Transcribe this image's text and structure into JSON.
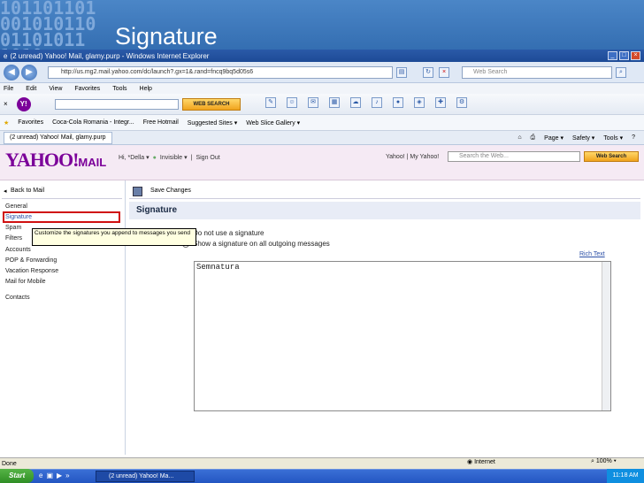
{
  "slide": {
    "binary_deco": "101101101\n001010110\n01101011\n1010",
    "title": "Signature"
  },
  "window": {
    "title": "(2 unread) Yahoo! Mail, glamy.purp - Windows Internet Explorer",
    "url": "http://us.mg2.mail.yahoo.com/dc/launch?.gx=1&.rand=fncq9bq5d05s6",
    "websearch_placeholder": "Web Search"
  },
  "menu": [
    "File",
    "Edit",
    "View",
    "Favorites",
    "Tools",
    "Help"
  ],
  "toolbar": {
    "web_search_btn": "WEB SEARCH"
  },
  "favorites": {
    "label": "Favorites",
    "items": [
      "Coca-Cola Romania - Integr...",
      "Free Hotmail",
      "Suggested Sites ▾",
      "Web Slice Gallery ▾"
    ]
  },
  "tab": {
    "title": "(2 unread) Yahoo! Mail, glamy.purp"
  },
  "cmdbar": [
    "Page ▾",
    "Safety ▾",
    "Tools ▾"
  ],
  "yahoo": {
    "logo": "YAHOO!",
    "logo_mail": "MAIL",
    "greeting": "Hi, *Della ▾",
    "invisible": "Invisible ▾",
    "signout": "Sign Out",
    "links": "Yahoo! | My Yahoo!",
    "search_placeholder": "Search the Web...",
    "search_btn": "Web Search"
  },
  "leftnav": {
    "back": "Back to Mail",
    "general": "General",
    "signature": "Signature",
    "spam": "Spam",
    "filters": "Filters",
    "accounts": "Accounts",
    "pop": "POP & Forwarding",
    "vacation": "Vacation Response",
    "mobile": "Mail for Mobile",
    "contacts": "Contacts"
  },
  "tooltip": "Customize the signatures you append to messages you send",
  "main": {
    "save": "Save Changes",
    "header": "Signature",
    "radio1": "Do not use a signature",
    "radio2": "Show a signature on all outgoing messages",
    "rich_text": "Rich Text",
    "editor_value": "Semnatura"
  },
  "status": {
    "left": "Done",
    "zone": "Internet",
    "zoom": "100%"
  },
  "taskbar": {
    "start": "Start",
    "task": "(2 unread) Yahoo! Ma...",
    "time": "11:18 AM"
  },
  "colors": {
    "yahoo_purple": "#7b0099",
    "highlight_red": "#d01010",
    "header_blue": "#2f69ad"
  }
}
